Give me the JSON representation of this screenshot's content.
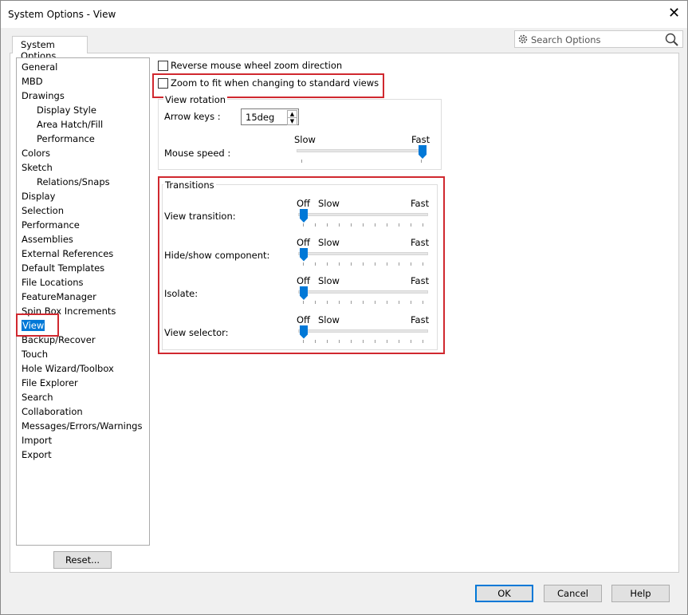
{
  "window": {
    "title": "System Options - View",
    "close": "✕"
  },
  "tab": "System Options",
  "search": {
    "placeholder": "Search Options"
  },
  "tree": [
    {
      "label": "General",
      "level": 0
    },
    {
      "label": "MBD",
      "level": 0
    },
    {
      "label": "Drawings",
      "level": 0
    },
    {
      "label": "Display Style",
      "level": 1
    },
    {
      "label": "Area Hatch/Fill",
      "level": 1
    },
    {
      "label": "Performance",
      "level": 1
    },
    {
      "label": "Colors",
      "level": 0
    },
    {
      "label": "Sketch",
      "level": 0
    },
    {
      "label": "Relations/Snaps",
      "level": 1
    },
    {
      "label": "Display",
      "level": 0
    },
    {
      "label": "Selection",
      "level": 0
    },
    {
      "label": "Performance",
      "level": 0
    },
    {
      "label": "Assemblies",
      "level": 0
    },
    {
      "label": "External References",
      "level": 0
    },
    {
      "label": "Default Templates",
      "level": 0
    },
    {
      "label": "File Locations",
      "level": 0
    },
    {
      "label": "FeatureManager",
      "level": 0
    },
    {
      "label": "Spin Box Increments",
      "level": 0
    },
    {
      "label": "View",
      "level": 0,
      "selected": true
    },
    {
      "label": "Backup/Recover",
      "level": 0
    },
    {
      "label": "Touch",
      "level": 0
    },
    {
      "label": "Hole Wizard/Toolbox",
      "level": 0
    },
    {
      "label": "File Explorer",
      "level": 0
    },
    {
      "label": "Search",
      "level": 0
    },
    {
      "label": "Collaboration",
      "level": 0
    },
    {
      "label": "Messages/Errors/Warnings",
      "level": 0
    },
    {
      "label": "Import",
      "level": 0
    },
    {
      "label": "Export",
      "level": 0
    }
  ],
  "reset": "Reset...",
  "options": {
    "reverse_wheel": {
      "label": "Reverse mouse wheel zoom direction",
      "checked": false
    },
    "zoom_to_fit": {
      "label": "Zoom to fit when changing to standard views",
      "checked": false
    }
  },
  "view_rotation": {
    "title": "View rotation",
    "arrow_keys_label": "Arrow keys :",
    "arrow_keys_value": "15deg",
    "mouse_speed_label": "Mouse speed :",
    "slow": "Slow",
    "fast": "Fast",
    "mouse_speed_value": 1.0
  },
  "transitions": {
    "title": "Transitions",
    "off": "Off",
    "slow": "Slow",
    "fast": "Fast",
    "sliders": [
      {
        "label": "View transition:",
        "value": 0
      },
      {
        "label": "Hide/show component:",
        "value": 0
      },
      {
        "label": "Isolate:",
        "value": 0
      },
      {
        "label": "View selector:",
        "value": 0
      }
    ]
  },
  "buttons": {
    "ok": "OK",
    "cancel": "Cancel",
    "help": "Help"
  },
  "colors": {
    "accent": "#0078d7",
    "highlight": "#d0282f"
  }
}
